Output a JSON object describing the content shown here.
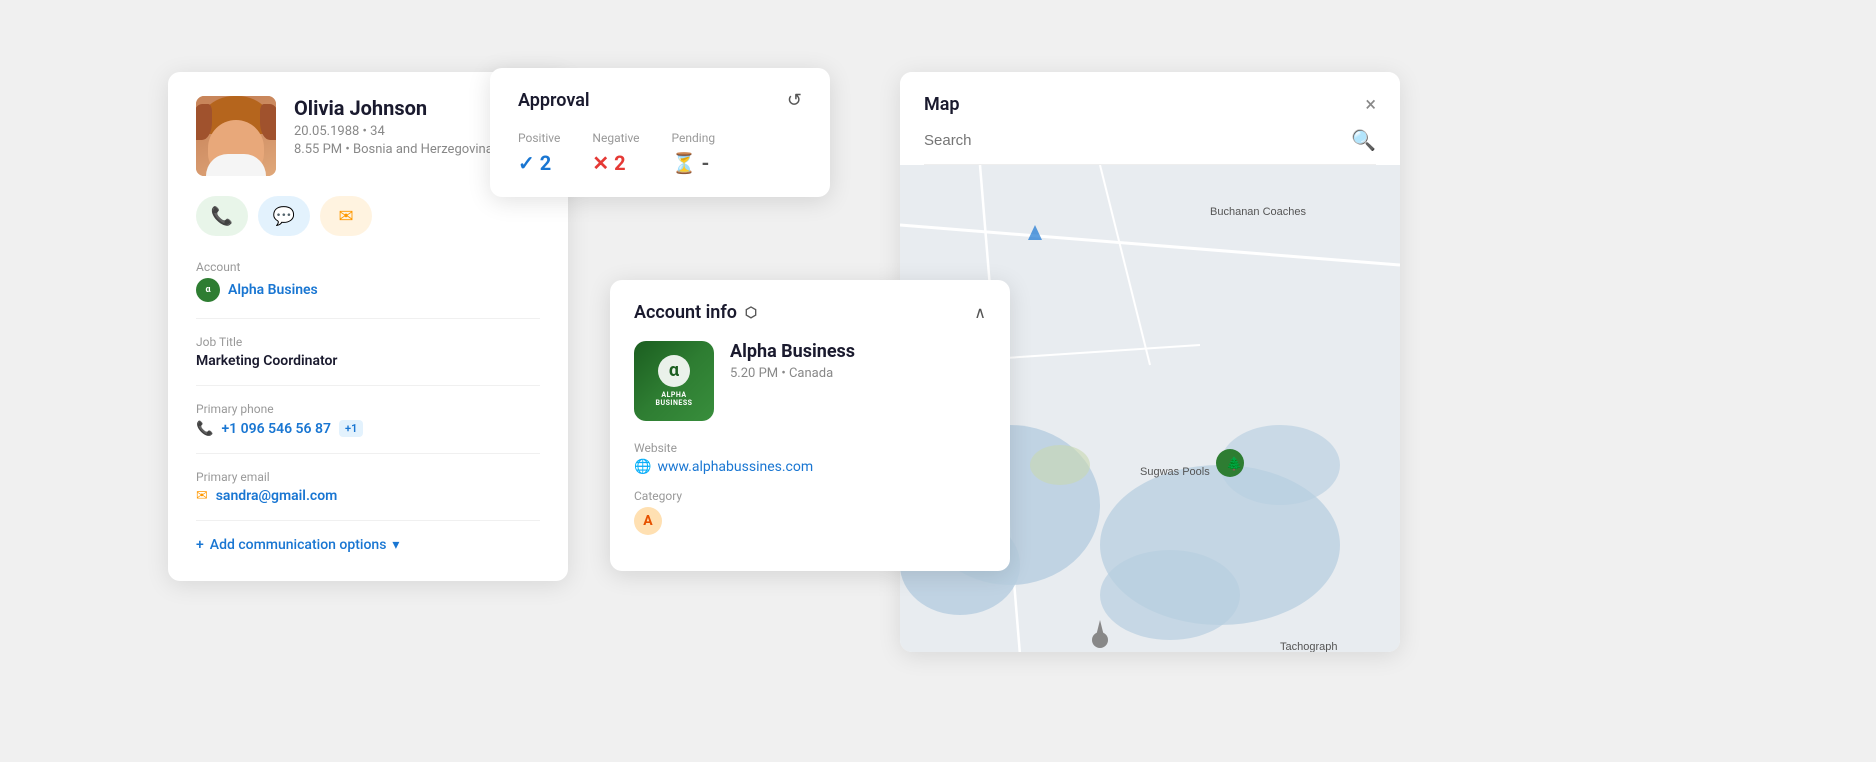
{
  "contact": {
    "name": "Olivia Johnson",
    "dob": "20.05.1988",
    "age": "34",
    "time": "8.55 PM",
    "location": "Bosnia and Herzegovina",
    "account": "Alpha Busines",
    "job_title": "Marketing Coordinator",
    "primary_phone": "+1 096 546 56 87",
    "phone_extra": "+1",
    "primary_email": "sandra@gmail.com",
    "add_comm_label": "Add communication options"
  },
  "approval": {
    "title": "Approval",
    "positive_label": "Positive",
    "negative_label": "Negative",
    "pending_label": "Pending",
    "positive_value": "2",
    "negative_value": "2",
    "pending_value": "-"
  },
  "account_info": {
    "title": "Account info",
    "company_name": "Alpha Business",
    "company_time": "5.20 PM",
    "company_location": "Canada",
    "website_label": "Website",
    "website_url": "www.alphabussines.com",
    "category_label": "Category",
    "category_value": "A"
  },
  "map": {
    "title": "Map",
    "search_placeholder": "Search",
    "close_label": "×",
    "label_buchanan": "Buchanan Coaches",
    "label_sugwas": "Sugwas Pools",
    "label_tachograph": "Tachograph"
  },
  "actions": {
    "phone_icon": "📞",
    "chat_icon": "💬",
    "email_icon": "✉"
  }
}
